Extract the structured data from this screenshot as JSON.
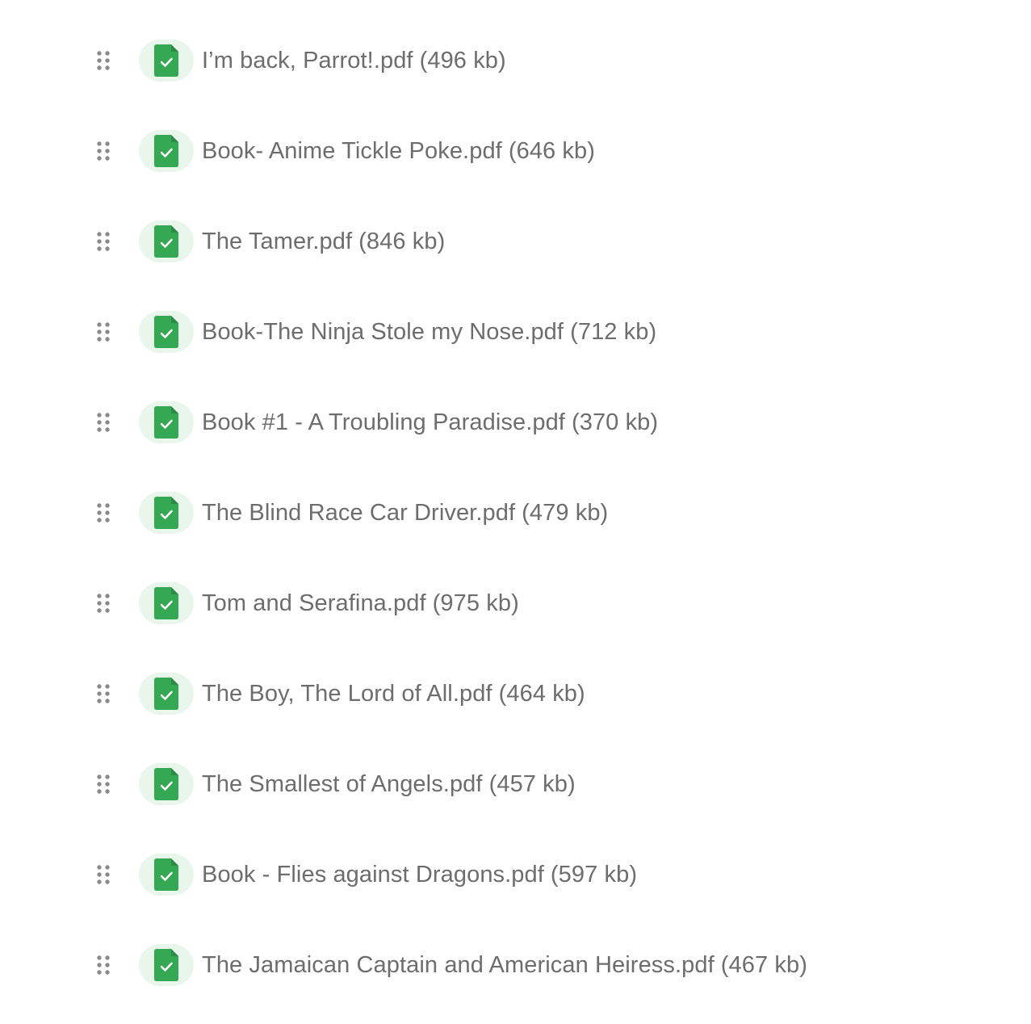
{
  "colors": {
    "icon_green": "#34a853",
    "icon_bg": "#e9f6ec",
    "text": "#6d6d6d",
    "handle": "#8a8a8a"
  },
  "icons": {
    "drag": "drag-handle-icon",
    "file": "file-check-icon"
  },
  "files": [
    {
      "name": "I’m back, Parrot!.pdf",
      "size": "(496 kb)"
    },
    {
      "name": "Book- Anime Tickle Poke.pdf",
      "size": "(646 kb)"
    },
    {
      "name": "The Tamer.pdf",
      "size": "(846 kb)"
    },
    {
      "name": "Book-The Ninja Stole my Nose.pdf",
      "size": "(712 kb)"
    },
    {
      "name": "Book #1 - A Troubling Paradise.pdf",
      "size": "(370 kb)"
    },
    {
      "name": "The Blind Race Car Driver.pdf",
      "size": "(479 kb)"
    },
    {
      "name": "Tom and Serafina.pdf",
      "size": "(975 kb)"
    },
    {
      "name": "The Boy, The Lord of All.pdf",
      "size": "(464 kb)"
    },
    {
      "name": "The Smallest of Angels.pdf",
      "size": "(457 kb)"
    },
    {
      "name": "Book - Flies against Dragons.pdf",
      "size": "(597 kb)"
    },
    {
      "name": "The Jamaican Captain and American Heiress.pdf",
      "size": "(467 kb)"
    }
  ]
}
